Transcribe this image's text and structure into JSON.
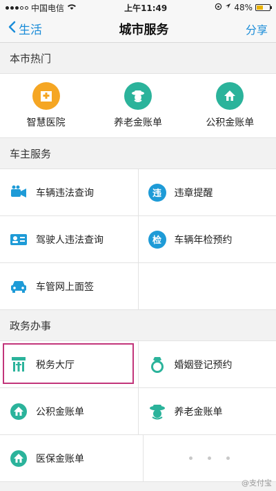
{
  "status": {
    "carrier": "中国电信",
    "time": "上午11:49",
    "battery": "48%",
    "battery_level": 0.48
  },
  "nav": {
    "back_label": "生活",
    "title": "城市服务",
    "share_label": "分享"
  },
  "sections": {
    "hot_title": "本市热门",
    "car_title": "车主服务",
    "gov_title": "政务办事"
  },
  "hot": {
    "items": [
      {
        "label": "智慧医院",
        "icon": "hospital-icon",
        "color": "#f5a623"
      },
      {
        "label": "养老金账单",
        "icon": "elder-icon",
        "color": "#2bb39b"
      },
      {
        "label": "公积金账单",
        "icon": "house-fund-icon",
        "color": "#2bb39b"
      }
    ]
  },
  "car": {
    "items": [
      {
        "label": "车辆违法查询",
        "icon": "car-camera-icon"
      },
      {
        "label": "违章提醒",
        "icon": "violation-alert-icon",
        "glyph": "违"
      },
      {
        "label": "驾驶人违法查询",
        "icon": "driver-license-icon"
      },
      {
        "label": "车辆年检预约",
        "icon": "inspection-icon",
        "glyph": "检"
      },
      {
        "label": "车管网上面签",
        "icon": "car-icon"
      }
    ]
  },
  "gov": {
    "items": [
      {
        "label": "税务大厅",
        "icon": "tax-hall-icon"
      },
      {
        "label": "婚姻登记预约",
        "icon": "marriage-ring-icon"
      },
      {
        "label": "公积金账单",
        "icon": "house-fund-icon"
      },
      {
        "label": "养老金账单",
        "icon": "elder-icon"
      },
      {
        "label": "医保金账单",
        "icon": "medical-insurance-icon"
      }
    ]
  },
  "watermark": "@支付宝",
  "colors": {
    "accent_blue": "#1a8cd8",
    "icon_blue": "#1e9bd7",
    "teal": "#2bb39b",
    "orange": "#f5a623",
    "highlight": "#c2347a"
  }
}
